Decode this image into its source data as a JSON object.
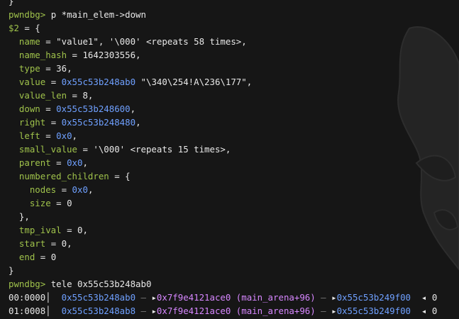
{
  "colors": {
    "background": "#161616",
    "prompt_green": "#9fc24b",
    "address_blue": "#6fa0ff",
    "address_magenta": "#d787ff",
    "text": "#e8e8e8"
  },
  "terminal": {
    "top_partial": "}",
    "prompt": "pwndbg>",
    "command1": "p *main_elem->down",
    "result_var": "$2",
    "open_brace": " = {",
    "fields": [
      {
        "name": "name",
        "value": "\"value1\", '\\000' <repeats 58 times>,",
        "color": "text"
      },
      {
        "name": "name_hash",
        "value": "1642303556,",
        "color": "text"
      },
      {
        "name": "type",
        "value": "36,",
        "color": "text"
      },
      {
        "name": "value",
        "addr": "0x55c53b248ab0",
        "value": " \"\\340\\254!A\\236\\177\",",
        "color": "mixed"
      },
      {
        "name": "value_len",
        "value": "8,",
        "color": "text"
      },
      {
        "name": "down",
        "addr": "0x55c53b248600",
        "value": ",",
        "color": "mixed"
      },
      {
        "name": "right",
        "addr": "0x55c53b248480",
        "value": ",",
        "color": "mixed"
      },
      {
        "name": "left",
        "addr": "0x0",
        "value": ",",
        "color": "mixed"
      },
      {
        "name": "small_value",
        "value": "'\\000' <repeats 15 times>,",
        "color": "text"
      },
      {
        "name": "parent",
        "addr": "0x0",
        "value": ",",
        "color": "mixed"
      }
    ],
    "numbered_children_label": "numbered_children",
    "numbered_children_open": " = {",
    "children_fields": [
      {
        "name": "nodes",
        "addr": "0x0",
        "value": ","
      },
      {
        "name": "size",
        "value": "0"
      }
    ],
    "children_close": "},",
    "tail_fields": [
      {
        "name": "tmp_ival",
        "value": "0,"
      },
      {
        "name": "start",
        "value": "0,"
      },
      {
        "name": "end",
        "value": "0"
      }
    ],
    "close_brace": "}",
    "command2": "tele 0x55c53b248ab0",
    "tele": [
      {
        "offset": "00:0000",
        "addr": "0x55c53b248ab0",
        "ptr": "0x7f9e4121ace0 (main_arena+96)",
        "next": "0x55c53b249f00",
        "last": "0"
      },
      {
        "offset": "01:0008",
        "addr": "0x55c53b248ab8",
        "ptr": "0x7f9e4121ace0 (main_arena+96)",
        "next": "0x55c53b249f00",
        "last": "0"
      }
    ]
  }
}
